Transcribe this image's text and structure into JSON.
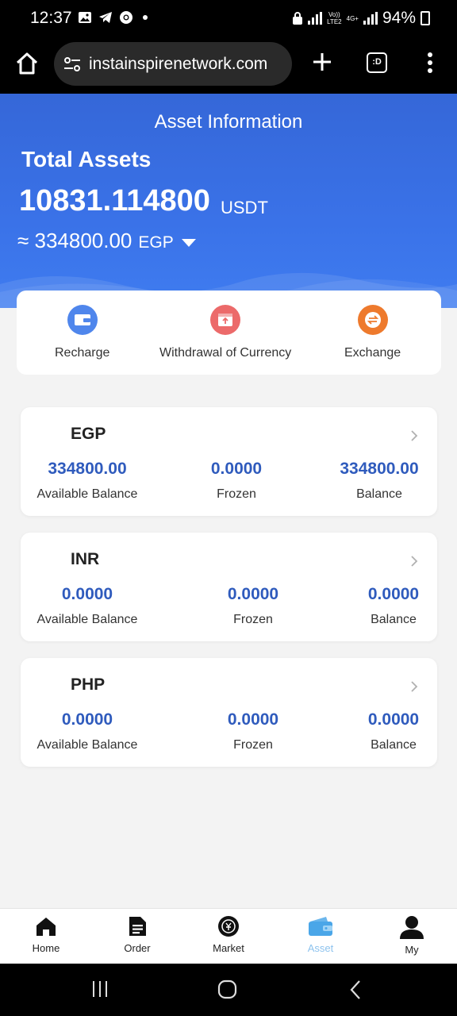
{
  "status_bar": {
    "time": "12:37",
    "network_top": "Vo))",
    "network_bottom": "LTE2",
    "network_4g": "4G+",
    "battery": "94%",
    "icons": [
      "photo-icon",
      "telegram-icon",
      "chrome-icon",
      "lock-icon",
      "signal-icon",
      "battery-icon"
    ]
  },
  "browser": {
    "url": "instainspirenetwork.com",
    "tabs_label": ":D"
  },
  "header": {
    "title": "Asset Information",
    "total_label": "Total Assets",
    "total_amount": "10831.114800",
    "total_unit": "USDT",
    "approx_amount": "≈ 334800.00",
    "approx_unit": "EGP"
  },
  "actions": [
    {
      "label": "Recharge",
      "icon": "wallet-icon",
      "color": "#4f86ec"
    },
    {
      "label": "Withdrawal of Currency",
      "icon": "withdraw-icon",
      "color": "#ec6a6a"
    },
    {
      "label": "Exchange",
      "icon": "exchange-icon",
      "color": "#ee7a2d"
    }
  ],
  "currencies": [
    {
      "name": "EGP",
      "available": "334800.00",
      "frozen": "0.0000",
      "balance": "334800.00"
    },
    {
      "name": "INR",
      "available": "0.0000",
      "frozen": "0.0000",
      "balance": "0.0000"
    },
    {
      "name": "PHP",
      "available": "0.0000",
      "frozen": "0.0000",
      "balance": "0.0000"
    }
  ],
  "labels": {
    "available": "Available Balance",
    "frozen": "Frozen",
    "balance": "Balance"
  },
  "nav": [
    {
      "label": "Home",
      "icon": "home-icon",
      "active": false
    },
    {
      "label": "Order",
      "icon": "order-icon",
      "active": false
    },
    {
      "label": "Market",
      "icon": "market-icon",
      "active": false
    },
    {
      "label": "Asset",
      "icon": "asset-wallet-icon",
      "active": true
    },
    {
      "label": "My",
      "icon": "user-icon",
      "active": false
    }
  ],
  "colors": {
    "header_blue": "#3a72e8",
    "value_blue": "#2f5bbd",
    "active_nav": "#8ec3ee"
  }
}
